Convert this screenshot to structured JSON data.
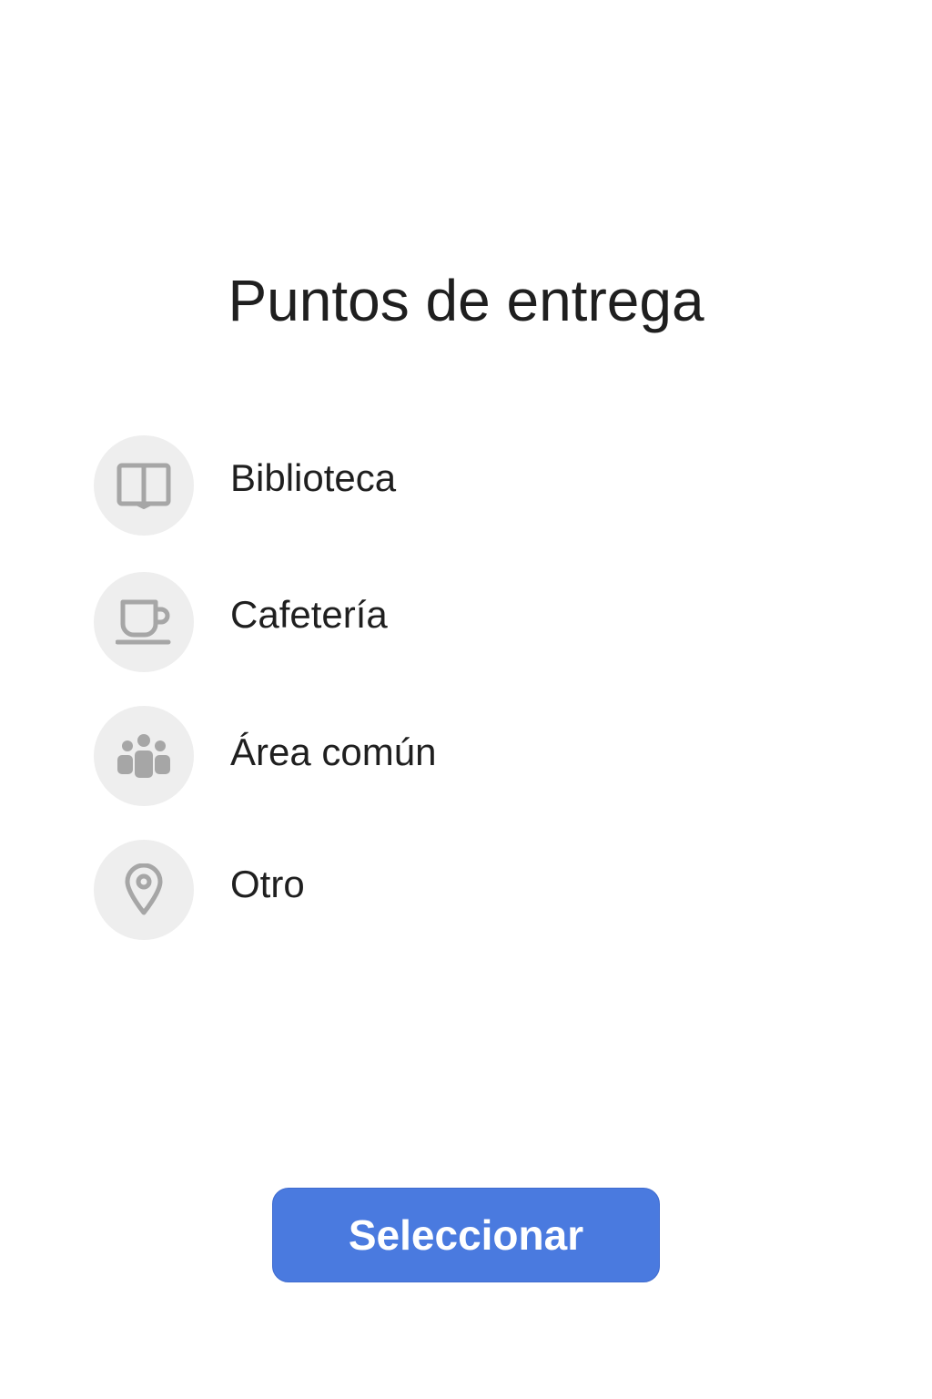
{
  "page": {
    "title": "Puntos de entrega"
  },
  "options": [
    {
      "label": "Biblioteca",
      "icon": "book-icon"
    },
    {
      "label": "Cafetería",
      "icon": "coffee-cup-icon"
    },
    {
      "label": "Área común",
      "icon": "group-icon"
    },
    {
      "label": "Otro",
      "icon": "location-pin-icon"
    }
  ],
  "actions": {
    "select_label": "Seleccionar"
  },
  "colors": {
    "accent": "#4a7adf",
    "icon_background": "#eeeeee",
    "icon_foreground": "#a6a6a6",
    "text": "#1f1f1f"
  }
}
